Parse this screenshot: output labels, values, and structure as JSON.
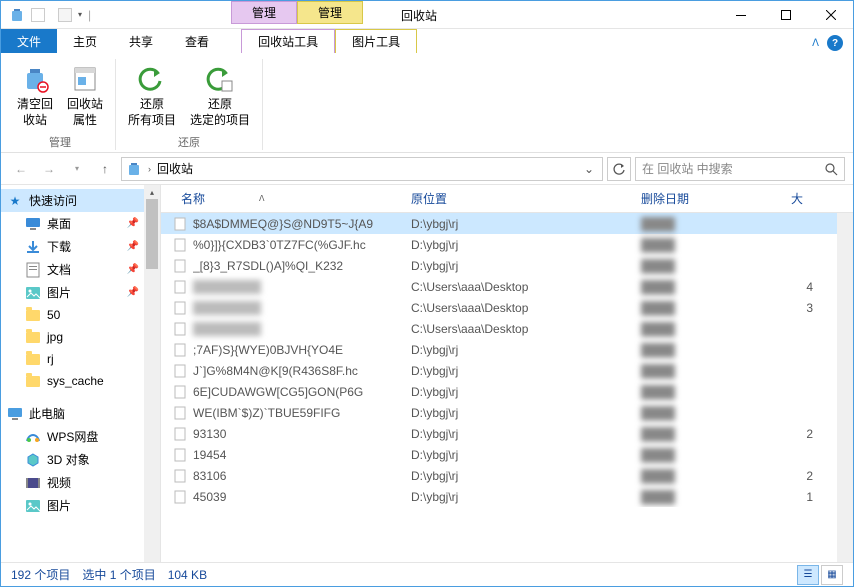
{
  "title": "回收站",
  "context_tabs": [
    {
      "header": "管理",
      "tab": "回收站工具"
    },
    {
      "header": "管理",
      "tab": "图片工具"
    }
  ],
  "tabs": {
    "file": "文件",
    "home": "主页",
    "share": "共享",
    "view": "查看"
  },
  "ribbon": {
    "manage": {
      "label": "管理",
      "empty": "清空回\n收站",
      "props": "回收站\n属性"
    },
    "restore": {
      "label": "还原",
      "all": "还原\n所有项目",
      "selected": "还原\n选定的项目"
    }
  },
  "address": {
    "path": "回收站"
  },
  "search": {
    "placeholder": "在 回收站 中搜索"
  },
  "sidebar": {
    "quick": "快速访问",
    "items": [
      {
        "icon": "desktop",
        "label": "桌面",
        "pinned": true
      },
      {
        "icon": "download",
        "label": "下载",
        "pinned": true
      },
      {
        "icon": "document",
        "label": "文档",
        "pinned": true
      },
      {
        "icon": "picture",
        "label": "图片",
        "pinned": true
      },
      {
        "icon": "folder",
        "label": "50"
      },
      {
        "icon": "folder",
        "label": "jpg"
      },
      {
        "icon": "folder",
        "label": "rj"
      },
      {
        "icon": "folder",
        "label": "sys_cache"
      }
    ],
    "thispc": "此电脑",
    "pc_items": [
      {
        "icon": "wps",
        "label": "WPS网盘"
      },
      {
        "icon": "3d",
        "label": "3D 对象"
      },
      {
        "icon": "video",
        "label": "视频"
      },
      {
        "icon": "picture",
        "label": "图片"
      }
    ]
  },
  "columns": {
    "name": "名称",
    "loc": "原位置",
    "date": "删除日期",
    "size": "大"
  },
  "rows": [
    {
      "name": "$8A$DMMEQ@}S@ND9T5~J{A9",
      "loc": "D:\\ybgj\\rj",
      "size": "",
      "selected": true
    },
    {
      "name": "%0}]}{CXDB3`0TZ7FC(%GJF.hc",
      "loc": "D:\\ybgj\\rj",
      "size": ""
    },
    {
      "name": "_[8}3_R7SDL()A]%QI_K232",
      "loc": "D:\\ybgj\\rj",
      "size": ""
    },
    {
      "name": "",
      "loc": "C:\\Users\\aaa\\Desktop",
      "size": "4",
      "blur": true
    },
    {
      "name": "",
      "loc": "C:\\Users\\aaa\\Desktop",
      "size": "3",
      "blur": true
    },
    {
      "name": "",
      "loc": "C:\\Users\\aaa\\Desktop",
      "size": "",
      "blur": true
    },
    {
      "name": ";7AF)S}{WYE)0BJVH{YO4E",
      "loc": "D:\\ybgj\\rj",
      "size": ""
    },
    {
      "name": "J`]G%8M4N@K[9(R436S8F.hc",
      "loc": "D:\\ybgj\\rj",
      "size": ""
    },
    {
      "name": "6E]CUDAWGW[CG5]GON(P6G",
      "loc": "D:\\ybgj\\rj",
      "size": ""
    },
    {
      "name": "WE(IBM`$)Z)`TBUE59FIFG",
      "loc": "D:\\ybgj\\rj",
      "size": ""
    },
    {
      "name": "93130",
      "loc": "D:\\ybgj\\rj",
      "size": "2"
    },
    {
      "name": "19454",
      "loc": "D:\\ybgj\\rj",
      "size": ""
    },
    {
      "name": "83106",
      "loc": "D:\\ybgj\\rj",
      "size": "2"
    },
    {
      "name": "45039",
      "loc": "D:\\ybgj\\rj",
      "size": "1"
    }
  ],
  "status": {
    "count": "192 个项目",
    "selected": "选中 1 个项目",
    "size": "104 KB"
  }
}
